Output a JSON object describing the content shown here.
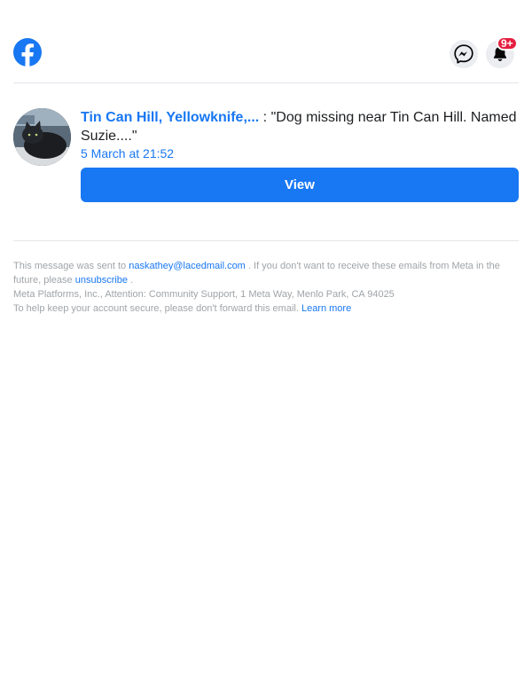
{
  "header": {
    "notification_badge": "9+"
  },
  "notification": {
    "group_name": "Tin Can Hill, Yellowknife,...",
    "separator": " : ",
    "quote_open": "\"",
    "post_excerpt": "Dog missing near Tin Can Hill. Named Suzie....",
    "quote_close": "\"",
    "timestamp": "5 March at 21:52",
    "view_label": "View"
  },
  "footer": {
    "line1_prefix": "This message was sent to ",
    "email": "naskathey@lacedmail.com",
    "line1_middle": " . If you don't want to receive these emails from Meta in the future, please ",
    "unsubscribe_label": "unsubscribe",
    "line1_end": " .",
    "address": "Meta Platforms, Inc., Attention: Community Support, 1 Meta Way, Menlo Park, CA 94025",
    "security_text": "To help keep your account secure, please don't forward this email. ",
    "learn_more_label": "Learn more"
  },
  "colors": {
    "facebook_blue": "#1877f2",
    "badge_red": "#e41e3f",
    "icon_circle_bg": "#ebedf0",
    "footer_text": "#a0a4a8",
    "divider": "#e4e6eb"
  }
}
